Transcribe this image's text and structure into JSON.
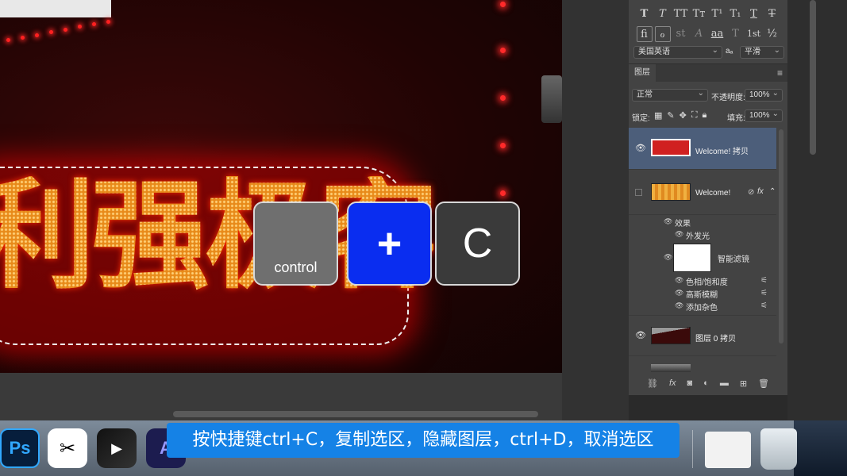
{
  "canvas": {
    "sign_text": "利强极客"
  },
  "keys": {
    "control": "control",
    "plus": "+",
    "c": "C"
  },
  "character_panel": {
    "style_glyphs": [
      "T",
      "T",
      "TT",
      "Tт",
      "T¹",
      "T₁",
      "T",
      "T"
    ],
    "opentype_glyphs": [
      "fi",
      "ℴ",
      "st",
      "A",
      "aa",
      "T",
      "1st",
      "½"
    ],
    "language": "美国英语",
    "aa_label": "aₐ",
    "antialias": "平滑"
  },
  "layers_panel": {
    "tab": "图层",
    "blend_mode": "正常",
    "opacity_label": "不透明度:",
    "opacity_value": "100%",
    "lock_label": "锁定:",
    "fill_label": "填充:",
    "fill_value": "100%",
    "layers": [
      {
        "name": "Welcome! 拷贝",
        "selected": true,
        "visible": true
      },
      {
        "name": "Welcome!",
        "selected": false,
        "visible": false,
        "fx": "fx"
      },
      {
        "name": "图层 0 拷贝",
        "selected": false,
        "visible": true
      }
    ],
    "effects_label": "效果",
    "outer_glow": "外发光",
    "smart_filters": "智能滤镜",
    "filters": [
      "色相/饱和度",
      "高斯模糊",
      "添加杂色"
    ]
  },
  "dock": {
    "apps": [
      "Ps",
      "✂",
      "▶",
      "A"
    ]
  },
  "subtitle": "按快捷键ctrl+C，复制选区，隐藏图层，ctrl+D，取消选区",
  "colors": {
    "accent_blue": "#0a2df0",
    "subtitle_bg": "#1582e6",
    "selected_layer": "#4c5e7a"
  }
}
